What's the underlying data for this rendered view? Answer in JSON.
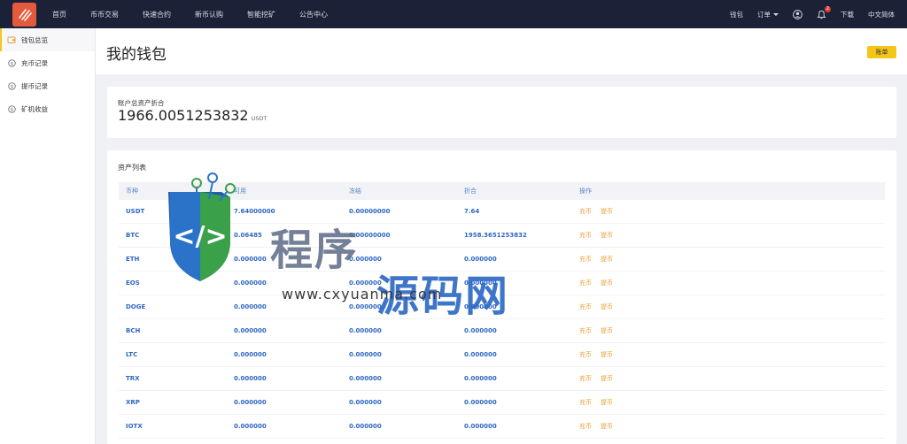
{
  "nav": {
    "items": [
      "首页",
      "币币交易",
      "快速合约",
      "新币认购",
      "智能挖矿",
      "公告中心"
    ],
    "right": {
      "wallet": "钱包",
      "orders": "订单",
      "download": "下载",
      "language": "中文简体",
      "notification_count": "2"
    }
  },
  "sidebar": {
    "items": [
      {
        "label": "钱包总览",
        "icon": "wallet-icon"
      },
      {
        "label": "充币记录",
        "icon": "coin-icon"
      },
      {
        "label": "提币记录",
        "icon": "coin-icon"
      },
      {
        "label": "矿机收益",
        "icon": "coin-icon"
      }
    ]
  },
  "header": {
    "title": "我的钱包",
    "bill_button": "账单"
  },
  "summary": {
    "label": "账户总资产折合",
    "value": "1966.0051253832",
    "unit": "USDT"
  },
  "assets": {
    "title": "资产列表",
    "columns": [
      "币种",
      "可用",
      "冻结",
      "折合",
      "操作"
    ],
    "deposit_label": "充币",
    "withdraw_label": "提币",
    "rows": [
      {
        "coin": "USDT",
        "available": "7.64000000",
        "frozen": "0.00000000",
        "equiv": "7.64"
      },
      {
        "coin": "BTC",
        "available": "0.06485",
        "frozen": "0.00000000",
        "equiv": "1958.3651253832"
      },
      {
        "coin": "ETH",
        "available": "0.000000",
        "frozen": "0.000000",
        "equiv": "0.000000"
      },
      {
        "coin": "EOS",
        "available": "0.000000",
        "frozen": "0.000000",
        "equiv": "0.000000"
      },
      {
        "coin": "DOGE",
        "available": "0.000000",
        "frozen": "0.000000",
        "equiv": "0.000000"
      },
      {
        "coin": "BCH",
        "available": "0.000000",
        "frozen": "0.000000",
        "equiv": "0.000000"
      },
      {
        "coin": "LTC",
        "available": "0.000000",
        "frozen": "0.000000",
        "equiv": "0.000000"
      },
      {
        "coin": "TRX",
        "available": "0.000000",
        "frozen": "0.000000",
        "equiv": "0.000000"
      },
      {
        "coin": "XRP",
        "available": "0.000000",
        "frozen": "0.000000",
        "equiv": "0.000000"
      },
      {
        "coin": "IOTX",
        "available": "0.000000",
        "frozen": "0.000000",
        "equiv": "0.000000"
      }
    ]
  },
  "watermark": {
    "text_gray": "程序",
    "text_blue": "源码网",
    "url": "www.cxyuanma.com"
  },
  "colors": {
    "topbar": "#1b2238",
    "accent": "#f5c518",
    "link_blue": "#2f67c4",
    "action_orange": "#e6a23c",
    "logo": "#e55a3c"
  }
}
